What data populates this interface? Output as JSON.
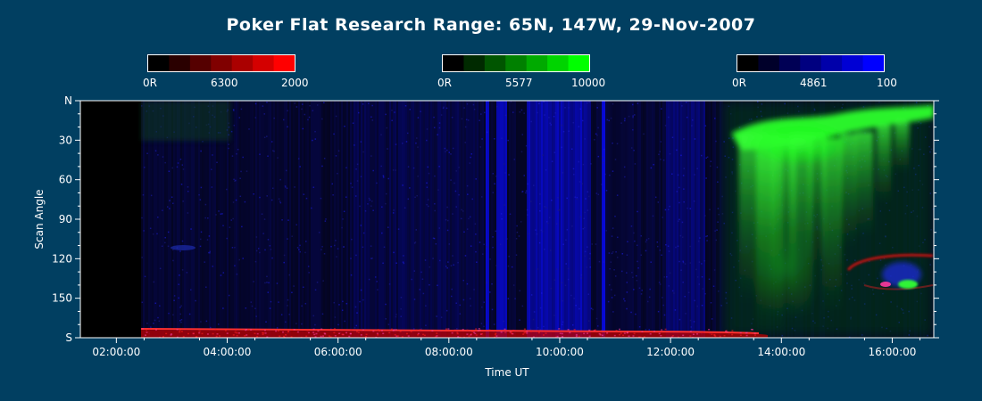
{
  "chart_data": {
    "type": "heatmap",
    "title": "Poker Flat Research Range: 65N, 147W, 29-Nov-2007",
    "xlabel": "Time UT",
    "ylabel": "Scan Angle",
    "x_ticks": [
      "02:00:00",
      "04:00:00",
      "06:00:00",
      "08:00:00",
      "10:00:00",
      "12:00:00",
      "14:00:00",
      "16:00:00"
    ],
    "x_tick_hours": [
      2,
      4,
      6,
      8,
      10,
      12,
      14,
      16
    ],
    "xlim_hours": [
      1.35,
      16.75
    ],
    "y_ticks": [
      "N",
      "30",
      "60",
      "90",
      "120",
      "150",
      "S"
    ],
    "y_tick_values": [
      0,
      30,
      60,
      90,
      120,
      150,
      180
    ],
    "ylim": [
      0,
      180
    ],
    "colorbars": [
      {
        "channel": "6300",
        "min_label": "0R",
        "mid_label": "6300",
        "max_label": "2000",
        "color": "#ff0000",
        "steps": [
          "#000000",
          "#2a0000",
          "#550000",
          "#800000",
          "#aa0000",
          "#d40000",
          "#ff0000"
        ]
      },
      {
        "channel": "5577",
        "min_label": "0R",
        "mid_label": "5577",
        "max_label": "10000",
        "color": "#00ff00",
        "steps": [
          "#000000",
          "#002a00",
          "#005500",
          "#008000",
          "#00aa00",
          "#00d400",
          "#00ff00"
        ]
      },
      {
        "channel": "4861",
        "min_label": "0R",
        "mid_label": "4861",
        "max_label": "100",
        "color": "#0000ff",
        "steps": [
          "#000000",
          "#00002a",
          "#000055",
          "#000080",
          "#0000aa",
          "#0000d4",
          "#0000ff"
        ]
      }
    ],
    "grid": false,
    "background_color": "#013f61"
  }
}
